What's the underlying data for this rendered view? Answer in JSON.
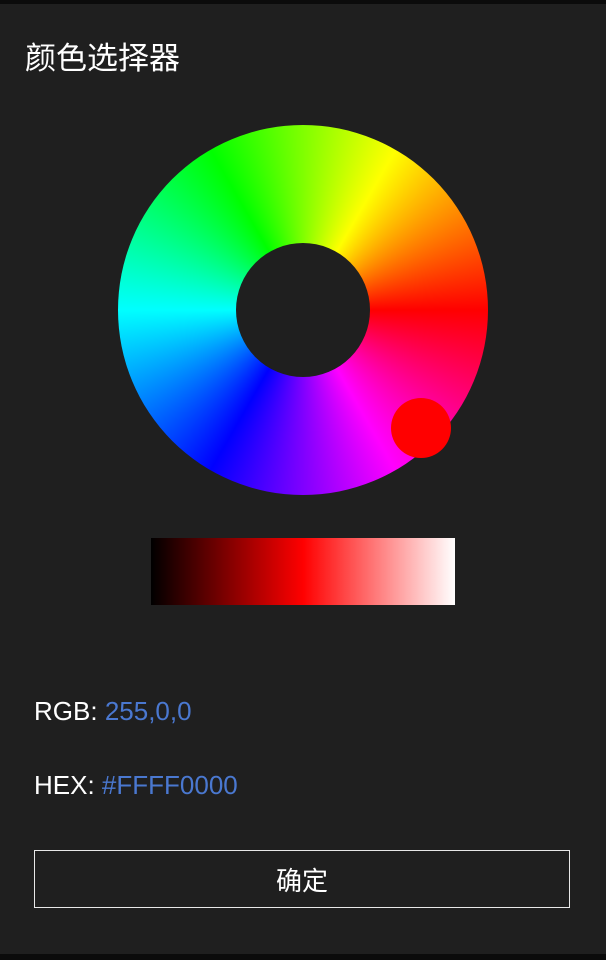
{
  "title": "颜色选择器",
  "selected_color": "#ff0000",
  "shade_bar": {
    "start": "#000000",
    "mid": "#ff0000",
    "end": "#ffffff"
  },
  "rgb": {
    "label": "RGB:",
    "value": "255,0,0"
  },
  "hex": {
    "label": "HEX:",
    "value": "#FFFF0000"
  },
  "confirm_label": "确定"
}
